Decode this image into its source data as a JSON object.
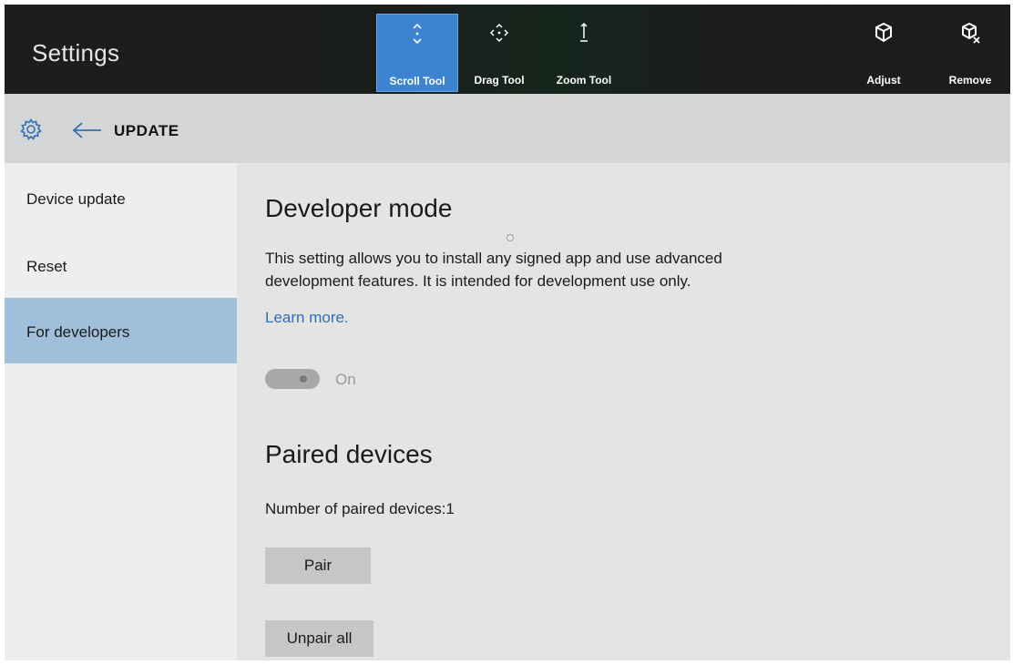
{
  "app_title": "Settings",
  "toolbar": {
    "tools": [
      {
        "label": "Scroll Tool",
        "icon": "scroll-icon",
        "selected": true
      },
      {
        "label": "Drag Tool",
        "icon": "drag-icon",
        "selected": false
      },
      {
        "label": "Zoom Tool",
        "icon": "zoom-icon",
        "selected": false
      }
    ],
    "actions": [
      {
        "label": "Adjust",
        "icon": "adjust-icon"
      },
      {
        "label": "Remove",
        "icon": "remove-icon"
      }
    ]
  },
  "header": {
    "icon": "gear-icon",
    "back_icon": "back-arrow-icon",
    "title": "UPDATE"
  },
  "sidebar": {
    "items": [
      {
        "label": "Device update",
        "selected": false
      },
      {
        "label": "Reset",
        "selected": false
      },
      {
        "label": "For developers",
        "selected": true
      }
    ]
  },
  "main": {
    "developer_mode": {
      "heading": "Developer mode",
      "description_line1": "This setting allows you to install any signed app and use advanced",
      "description_line2": "development features. It is intended for development use only.",
      "learn_more": "Learn more.",
      "toggle_state": "On",
      "toggle_on": true
    },
    "paired_devices": {
      "heading": "Paired devices",
      "count_text": "Number of paired devices:1",
      "pair_button": "Pair",
      "unpair_button": "Unpair all"
    }
  },
  "colors": {
    "titlebar": "#1d1d1d",
    "tool_selected": "#3c83d2",
    "headerbar": "#d4d5d6",
    "sidebar_selected": "#9fbfda",
    "link": "#2f6fb8"
  }
}
